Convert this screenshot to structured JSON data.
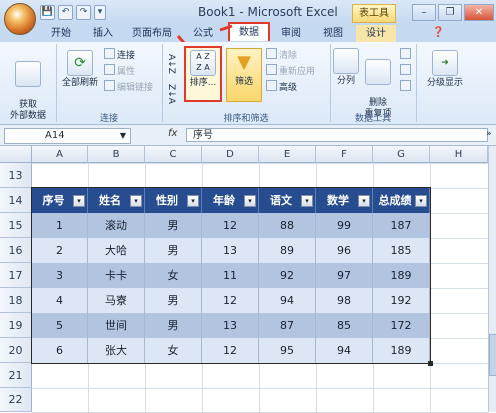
{
  "window": {
    "title": "Book1 - Microsoft Excel",
    "contextual_tab": "表工具",
    "controls": [
      "–",
      "❐",
      "✕"
    ]
  },
  "quick_access": [
    "💾",
    "↶",
    "↷",
    "▾"
  ],
  "tabs": [
    {
      "label": "开始"
    },
    {
      "label": "插入"
    },
    {
      "label": "页面布局"
    },
    {
      "label": "公式"
    },
    {
      "label": "数据"
    },
    {
      "label": "审阅"
    },
    {
      "label": "视图"
    },
    {
      "label": "设计"
    }
  ],
  "ribbon": {
    "get_external": {
      "label": "获取\n外部数据"
    },
    "connections": {
      "refresh_all": "全部刷新",
      "items": [
        "连接",
        "属性",
        "编辑链接"
      ],
      "group_label": "连接"
    },
    "sort_filter": {
      "sort_asc": "A↓Z",
      "sort_desc": "Z↓A",
      "sort": "排序...",
      "filter": "筛选",
      "items": [
        "清除",
        "重新应用",
        "高级"
      ],
      "group_label": "排序和筛选"
    },
    "data_tools": {
      "split": "分列",
      "remove_dup": "删除\n重复项",
      "group_label": "数据工具"
    },
    "outline": {
      "label": "分级显示"
    }
  },
  "formula_bar": {
    "name_box": "A14",
    "fx": "fx",
    "formula": "序号"
  },
  "columns": [
    "A",
    "B",
    "C",
    "D",
    "E",
    "F",
    "G",
    "H"
  ],
  "rows": [
    "13",
    "14",
    "15",
    "16",
    "17",
    "18",
    "19",
    "20",
    "21",
    "22"
  ],
  "table": {
    "headers": [
      "序号",
      "姓名",
      "性别",
      "年龄",
      "语文",
      "数学",
      "总成绩"
    ],
    "rows": [
      [
        "1",
        "滚动",
        "男",
        "12",
        "88",
        "99",
        "187"
      ],
      [
        "2",
        "大哈",
        "男",
        "13",
        "89",
        "96",
        "185"
      ],
      [
        "3",
        "卡卡",
        "女",
        "11",
        "92",
        "97",
        "189"
      ],
      [
        "4",
        "马寮",
        "男",
        "12",
        "94",
        "98",
        "192"
      ],
      [
        "5",
        "世间",
        "男",
        "13",
        "87",
        "85",
        "172"
      ],
      [
        "6",
        "张大",
        "女",
        "12",
        "95",
        "94",
        "189"
      ]
    ]
  },
  "colors": {
    "header": "#274d90",
    "band_dark": "#b3c4e0",
    "band_light": "#dce6f4",
    "highlight": "#e23a2a"
  }
}
